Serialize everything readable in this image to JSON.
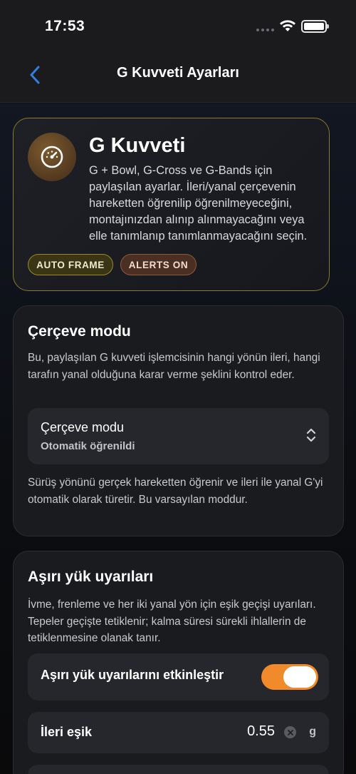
{
  "status_bar": {
    "time": "17:53",
    "icons": [
      "signal-dots-icon",
      "wifi-icon",
      "battery-icon"
    ]
  },
  "nav": {
    "title": "G Kuvveti Ayarları",
    "back_icon": "chevron-left-icon"
  },
  "hero": {
    "title": "G Kuvveti",
    "description": "G + Bowl, G-Cross ve G-Bands için paylaşılan ayarlar. İleri/yanal çerçevenin hareketten öğrenilip öğrenilmeyeceğini, montajınızdan alınıp alınmayacağını veya elle tanımlanıp tanımlanmayacağını seçin.",
    "icon": "gauge-icon",
    "chips": [
      {
        "label": "AUTO FRAME"
      },
      {
        "label": "ALERTS ON"
      }
    ]
  },
  "frame_mode": {
    "title": "Çerçeve modu",
    "description": "Bu, paylaşılan G kuvveti işlemcisinin hangi yönün ileri, hangi tarafın yanal olduğuna karar verme şeklini kontrol eder.",
    "select": {
      "label": "Çerçeve modu",
      "value": "Otomatik öğrenildi",
      "icon": "chevron-up-down-icon"
    },
    "footnote": "Sürüş yönünü gerçek hareketten öğrenir ve ileri ile yanal G'yi otomatik olarak türetir. Bu varsayılan moddur."
  },
  "overload_alerts": {
    "title": "Aşırı yük uyarıları",
    "description": "İvme, frenleme ve her iki yanal yön için eşik geçişi uyarıları. Tepeler geçişte tetiklenir; kalma süresi sürekli ihlallerin de tetiklenmesine olanak tanır.",
    "toggle": {
      "label": "Aşırı yük uyarılarını etkinleştir",
      "on": true,
      "color": "#f08a2a"
    },
    "forward_threshold": {
      "label": "İleri eşik",
      "value": "0.55",
      "unit": "g",
      "clear_icon": "clear-icon"
    }
  },
  "colors": {
    "accent": "#f08a2a",
    "back": "#2f7fe0",
    "chip_auto_border": "#9c8a2a",
    "chip_alerts_border": "#8e5a3c"
  }
}
